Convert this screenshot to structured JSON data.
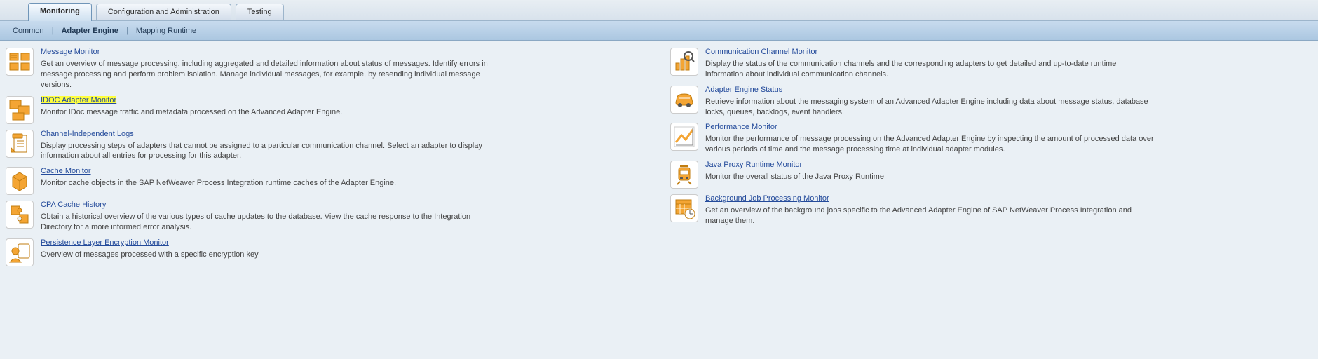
{
  "primaryTabs": {
    "t0": "Monitoring",
    "t1": "Configuration and Administration",
    "t2": "Testing"
  },
  "subTabs": {
    "s0": "Common",
    "s1": "Adapter Engine",
    "s2": "Mapping Runtime"
  },
  "left": [
    {
      "title": "Message Monitor",
      "desc": "Get an overview of message processing, including aggregated and detailed information about status of messages. Identify errors in message processing and perform problem isolation. Manage individual messages, for example, by resending individual message versions.",
      "icon": "message-monitor-icon",
      "hl": false
    },
    {
      "title": "IDOC Adapter Monitor",
      "desc": "Monitor IDoc message traffic and metadata processed on the Advanced Adapter Engine.",
      "icon": "idoc-monitor-icon",
      "hl": true
    },
    {
      "title": "Channel-Independent Logs",
      "desc": "Display processing steps of adapters that cannot be assigned to a particular communication channel. Select an adapter to display information about all entries for processing for this adapter.",
      "icon": "clipboard-icon",
      "hl": false
    },
    {
      "title": "Cache Monitor",
      "desc": "Monitor cache objects in the SAP NetWeaver Process Integration runtime caches of the Adapter Engine.",
      "icon": "box-icon",
      "hl": false
    },
    {
      "title": "CPA Cache History",
      "desc": "Obtain a historical overview of the various types of cache updates to the database. View the cache response to the Integration Directory for a more informed error analysis.",
      "icon": "puzzle-icon",
      "hl": false
    },
    {
      "title": "Persistence Layer Encryption Monitor",
      "desc": "Overview of messages processed with a specific encryption key",
      "icon": "person-badge-icon",
      "hl": false
    }
  ],
  "right": [
    {
      "title": "Communication Channel Monitor",
      "desc": "Display the status of the communication channels and the corresponding adapters to get detailed and up-to-date runtime information about individual communication channels.",
      "icon": "barchart-magnifier-icon",
      "hl": false
    },
    {
      "title": "Adapter Engine Status",
      "desc": "Retrieve information about the messaging system of an Advanced Adapter Engine including data about message status, database locks, queues, backlogs, event handlers.",
      "icon": "car-icon",
      "hl": false
    },
    {
      "title": "Performance Monitor",
      "desc": "Monitor the performance of message processing on the Advanced Adapter Engine by inspecting the amount of processed data over various periods of time and the message processing time at individual adapter modules.",
      "icon": "linechart-icon",
      "hl": false
    },
    {
      "title": "Java Proxy Runtime Monitor",
      "desc": "Monitor the overall status of the Java Proxy Runtime",
      "icon": "tram-icon",
      "hl": false
    },
    {
      "title": "Background Job Processing Monitor",
      "desc": "Get an overview of the background jobs specific to the Advanced Adapter Engine of SAP NetWeaver Process Integration and manage them.",
      "icon": "calendar-clock-icon",
      "hl": false
    }
  ]
}
